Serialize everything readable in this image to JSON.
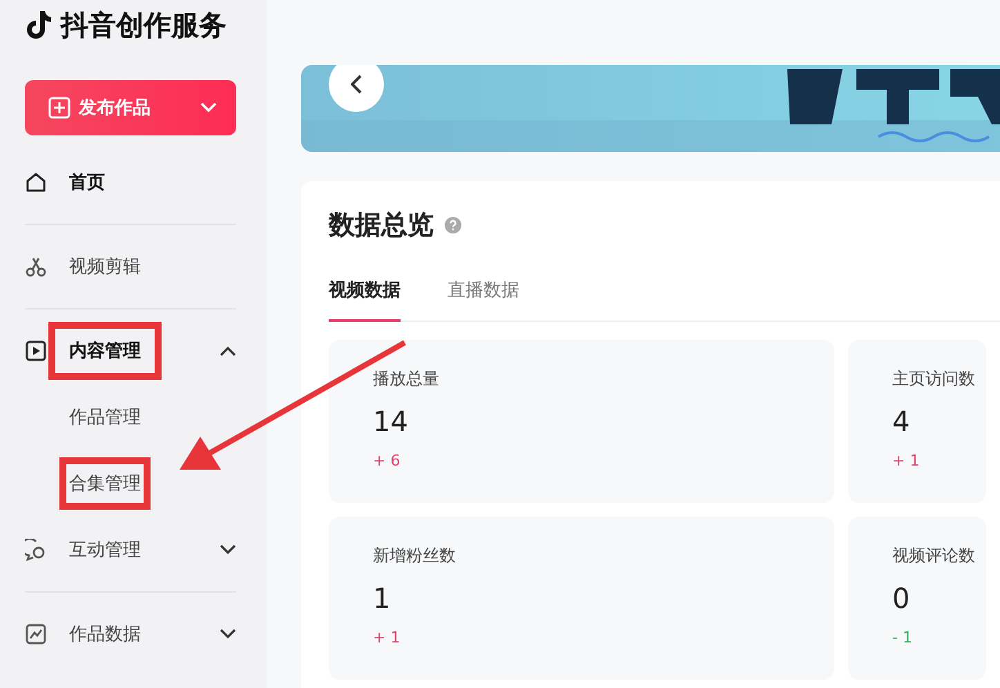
{
  "brand": {
    "name": "抖音创作服务"
  },
  "publish_button": {
    "label": "发布作品"
  },
  "sidebar": {
    "items": [
      {
        "kind": "item",
        "label": "首页",
        "bold": true,
        "highlighted": false
      },
      {
        "kind": "divider"
      },
      {
        "kind": "item",
        "label": "视频剪辑",
        "bold": false,
        "highlighted": false
      },
      {
        "kind": "divider"
      },
      {
        "kind": "group",
        "label": "内容管理",
        "bold": true,
        "expanded": true,
        "highlighted": true,
        "children": [
          {
            "label": "作品管理",
            "highlighted": false
          },
          {
            "label": "合集管理",
            "highlighted": true
          }
        ]
      },
      {
        "kind": "group",
        "label": "互动管理",
        "bold": false,
        "expanded": false,
        "highlighted": false
      },
      {
        "kind": "divider"
      },
      {
        "kind": "group",
        "label": "作品数据",
        "bold": false,
        "expanded": false,
        "highlighted": false
      }
    ]
  },
  "overview": {
    "title": "数据总览",
    "tabs": [
      {
        "label": "视频数据",
        "selected": true
      },
      {
        "label": "直播数据",
        "selected": false
      }
    ],
    "stats": [
      {
        "label": "播放总量",
        "value": "14",
        "delta": "+ 6",
        "color": "#e0406a"
      },
      {
        "label": "主页访问数",
        "value": "4",
        "delta": "+ 1",
        "color": "#e0406a"
      },
      {
        "label": "新增粉丝数",
        "value": "1",
        "delta": "+ 1",
        "color": "#e0406a"
      },
      {
        "label": "视频评论数",
        "value": "0",
        "delta": "- 1",
        "color": "#30b060"
      }
    ]
  },
  "annotations": [
    {
      "kind": "arrow"
    }
  ]
}
